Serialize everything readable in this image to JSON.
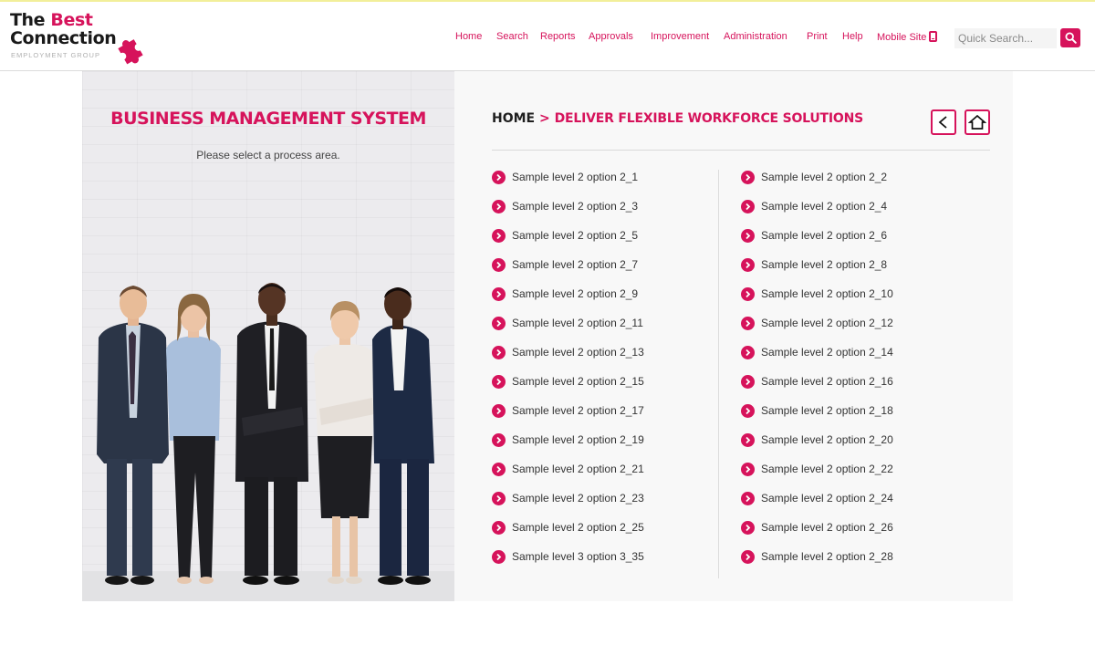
{
  "brand": {
    "logo_line1_prefix": "The ",
    "logo_line1_accent": "Best",
    "logo_line2": "Connection",
    "logo_sub": "EMPLOYMENT GROUP",
    "accent_color": "#d6135b"
  },
  "nav": {
    "items": [
      "Home",
      "Search",
      "Reports",
      "Approvals",
      "Improvement",
      "Administration",
      "Print",
      "Help",
      "Mobile Site"
    ],
    "mobile_icon": "mobile-phone-icon"
  },
  "search": {
    "placeholder": "Quick Search...",
    "value": "",
    "button_icon": "search-icon"
  },
  "hero": {
    "title": "BUSINESS MANAGEMENT SYSTEM",
    "subtitle": "Please select a process area."
  },
  "panel": {
    "breadcrumb_home": "HOME",
    "breadcrumb_sep": " > ",
    "breadcrumb_current": "DELIVER FLEXIBLE WORKFORCE SOLUTIONS",
    "back_icon": "back-arrow-icon",
    "home_icon": "home-icon"
  },
  "options": {
    "left": [
      "Sample level 2 option 2_1",
      "Sample level 2 option 2_3",
      "Sample level 2 option 2_5",
      "Sample level 2 option 2_7",
      "Sample level 2 option 2_9",
      "Sample level 2 option 2_11",
      "Sample level 2 option 2_13",
      "Sample level 2 option 2_15",
      "Sample level 2 option 2_17",
      "Sample level 2 option 2_19",
      "Sample level 2 option 2_21",
      "Sample level 2 option 2_23",
      "Sample level 2 option 2_25",
      "Sample level 3 option 3_35"
    ],
    "right": [
      "Sample level 2 option 2_2",
      "Sample level 2 option 2_4",
      "Sample level 2 option 2_6",
      "Sample level 2 option 2_8",
      "Sample level 2 option 2_10",
      "Sample level 2 option 2_12",
      "Sample level 2 option 2_14",
      "Sample level 2 option 2_16",
      "Sample level 2 option 2_18",
      "Sample level 2 option 2_20",
      "Sample level 2 option 2_22",
      "Sample level 2 option 2_24",
      "Sample level 2 option 2_26",
      "Sample level 2 option 2_28"
    ]
  }
}
